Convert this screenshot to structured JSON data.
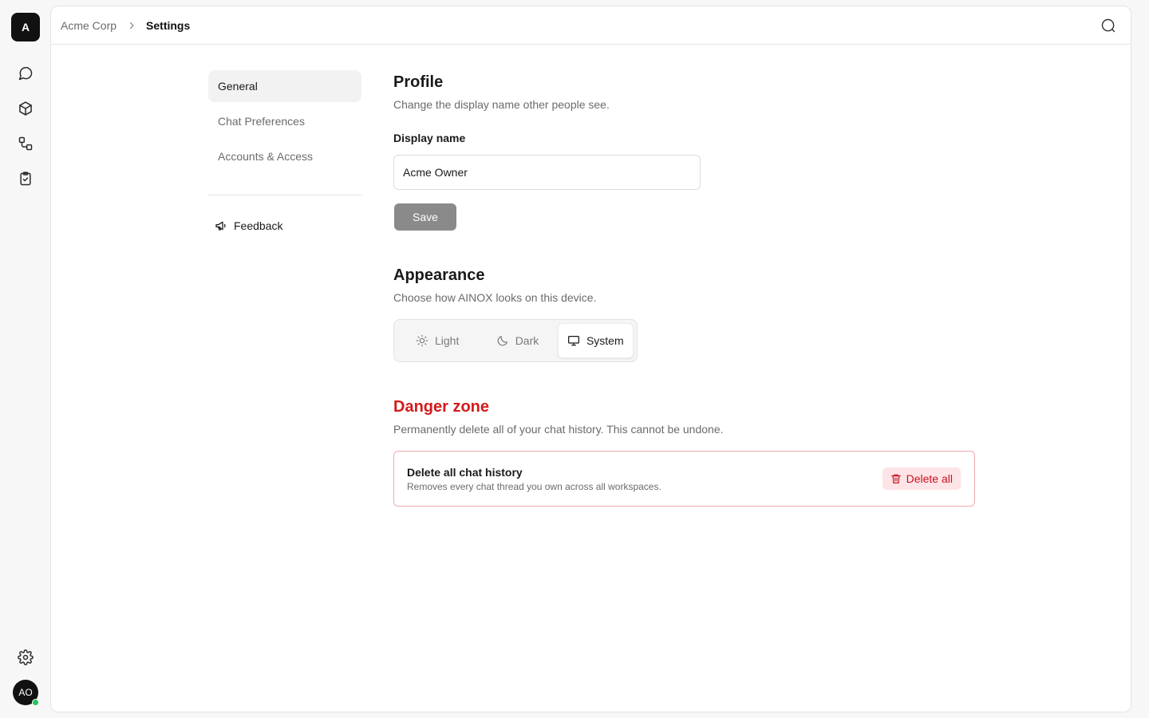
{
  "rail": {
    "logo_letter": "A",
    "items": [
      {
        "name": "chat",
        "icon": "chat-bubble-icon"
      },
      {
        "name": "models",
        "icon": "cube-icon"
      },
      {
        "name": "workflows",
        "icon": "workflow-icon"
      },
      {
        "name": "tasks",
        "icon": "clipboard-check-icon"
      }
    ],
    "settings_icon": "gear-icon",
    "avatar_initials": "AO",
    "presence_color": "#22c55e"
  },
  "topbar": {
    "breadcrumb_parent": "Acme Corp",
    "breadcrumb_current": "Settings",
    "action_icon": "search-icon"
  },
  "settings_nav": {
    "items": [
      {
        "label": "General",
        "active": true
      },
      {
        "label": "Chat Preferences",
        "active": false
      },
      {
        "label": "Accounts & Access",
        "active": false
      }
    ],
    "feedback_label": "Feedback",
    "feedback_icon": "megaphone-icon"
  },
  "profile": {
    "title": "Profile",
    "description": "Change the display name other people see.",
    "display_name_label": "Display name",
    "display_name_value": "Acme Owner",
    "save_label": "Save"
  },
  "appearance": {
    "title": "Appearance",
    "description": "Choose how AINOX looks on this device.",
    "options": [
      {
        "label": "Light",
        "icon": "sun-icon"
      },
      {
        "label": "Dark",
        "icon": "moon-icon"
      },
      {
        "label": "System",
        "icon": "monitor-icon"
      }
    ],
    "selected": "System"
  },
  "danger_zone": {
    "title": "Danger zone",
    "description": "Permanently delete all of your chat history. This cannot be undone.",
    "card_title": "Delete all chat history",
    "card_subtitle": "Removes every chat thread you own across all workspaces.",
    "delete_label": "Delete all",
    "delete_icon": "trash-icon",
    "accent_color": "#d31b1b"
  }
}
